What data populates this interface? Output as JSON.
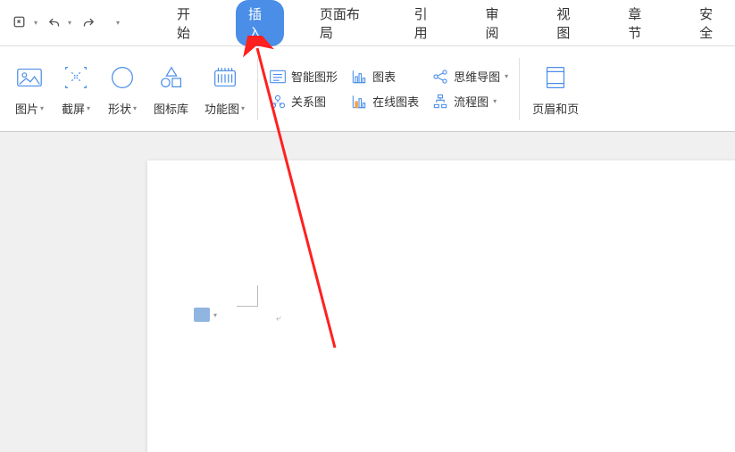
{
  "tabs": {
    "start": "开始",
    "insert": "插入",
    "pageLayout": "页面布局",
    "reference": "引用",
    "review": "审阅",
    "view": "视图",
    "section": "章节",
    "security": "安全"
  },
  "ribbon": {
    "picture": "图片",
    "screenshot": "截屏",
    "shapes": "形状",
    "iconLib": "图标库",
    "funcChart": "功能图",
    "smartArt": "智能图形",
    "chart": "图表",
    "relationChart": "关系图",
    "onlineChart": "在线图表",
    "mindMap": "思维导图",
    "flowChart": "流程图",
    "headerFooter": "页眉和页"
  }
}
